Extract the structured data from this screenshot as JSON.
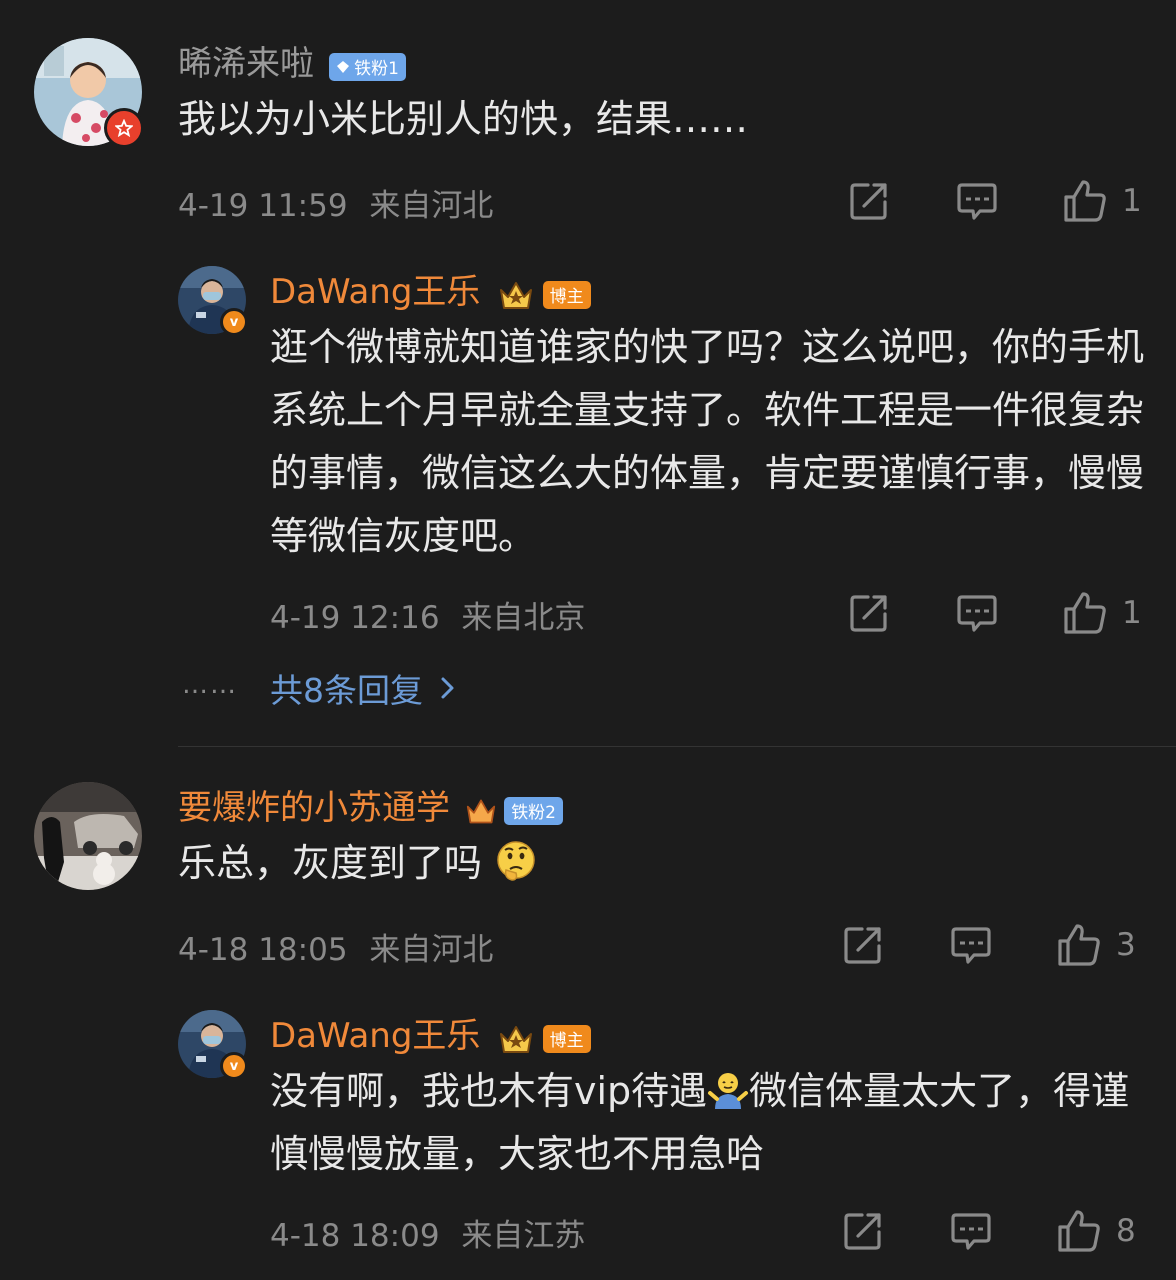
{
  "comments": [
    {
      "user": "晞浠来啦",
      "badge": "铁粉1",
      "text": "我以为小米比别人的快，结果……",
      "time": "4-19 11:59",
      "location": "来自河北",
      "likes": "1",
      "reply": {
        "user": "DaWang王乐",
        "badge": "博主",
        "text": "逛个微博就知道谁家的快了吗？这么说吧，你的手机系统上个月早就全量支持了。软件工程是一件很复杂的事情，微信这么大的体量，肯定要谨慎行事，慢慢等微信灰度吧。",
        "time": "4-19 12:16",
        "location": "来自北京",
        "likes": "1"
      },
      "more_dots": "……",
      "more_replies": "共8条回复"
    },
    {
      "user": "要爆炸的小苏通学",
      "badge": "铁粉2",
      "text": "乐总，灰度到了吗",
      "time": "4-18 18:05",
      "location": "来自河北",
      "likes": "3",
      "reply": {
        "user": "DaWang王乐",
        "badge": "博主",
        "text_part1": "没有啊，我也木有vip待遇",
        "text_part2": "微信体量太大了，得谨慎慢慢放量，大家也不用急哈",
        "time": "4-18 18:09",
        "location": "来自江苏",
        "likes": "8"
      }
    }
  ],
  "icons": {
    "share": "share-icon",
    "comment": "comment-icon",
    "like": "thumbs-up-icon",
    "chevron": "chevron-right-icon"
  },
  "colors": {
    "background": "#1c1c1c",
    "orange_name": "#f0893a",
    "link_blue": "#6c9bd6",
    "meta_gray": "#8a8a8a"
  }
}
